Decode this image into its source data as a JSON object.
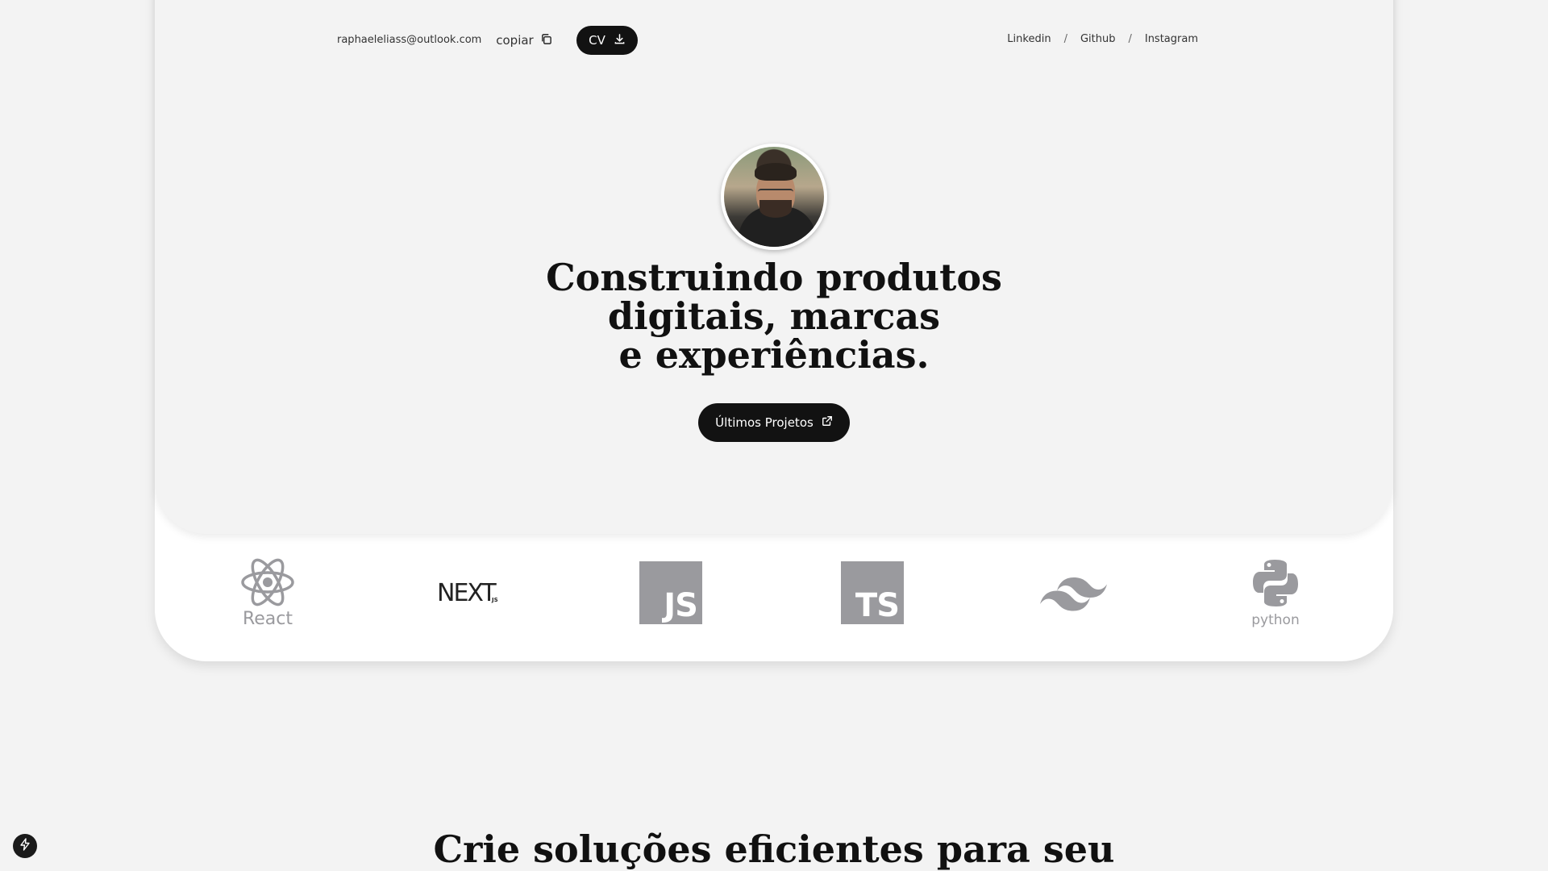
{
  "header": {
    "email": "raphaeleliass@outlook.com",
    "copy_label": "copiar",
    "cv_label": "CV",
    "social": [
      {
        "label": "Linkedin"
      },
      {
        "label": "Github"
      },
      {
        "label": "Instagram"
      }
    ],
    "separator": "/"
  },
  "hero": {
    "headline_lines": [
      "Construindo produtos",
      "digitais, marcas",
      "e experiências."
    ],
    "cta_label": "Últimos Projetos"
  },
  "tech": {
    "items": [
      {
        "name": "React",
        "label": "React"
      },
      {
        "name": "Next.js",
        "label": "NEXT",
        "sub": "JS"
      },
      {
        "name": "JavaScript",
        "label": "JS"
      },
      {
        "name": "TypeScript",
        "label": "TS"
      },
      {
        "name": "Tailwind CSS",
        "label": ""
      },
      {
        "name": "Python",
        "label": "python"
      }
    ],
    "icon_color": "#9a9a9e"
  },
  "section": {
    "title": "Crie soluções eficientes para seu"
  },
  "colors": {
    "background": "#f3f3f3",
    "card": "#ffffff",
    "dark_button": "#121212",
    "text": "#111111"
  }
}
